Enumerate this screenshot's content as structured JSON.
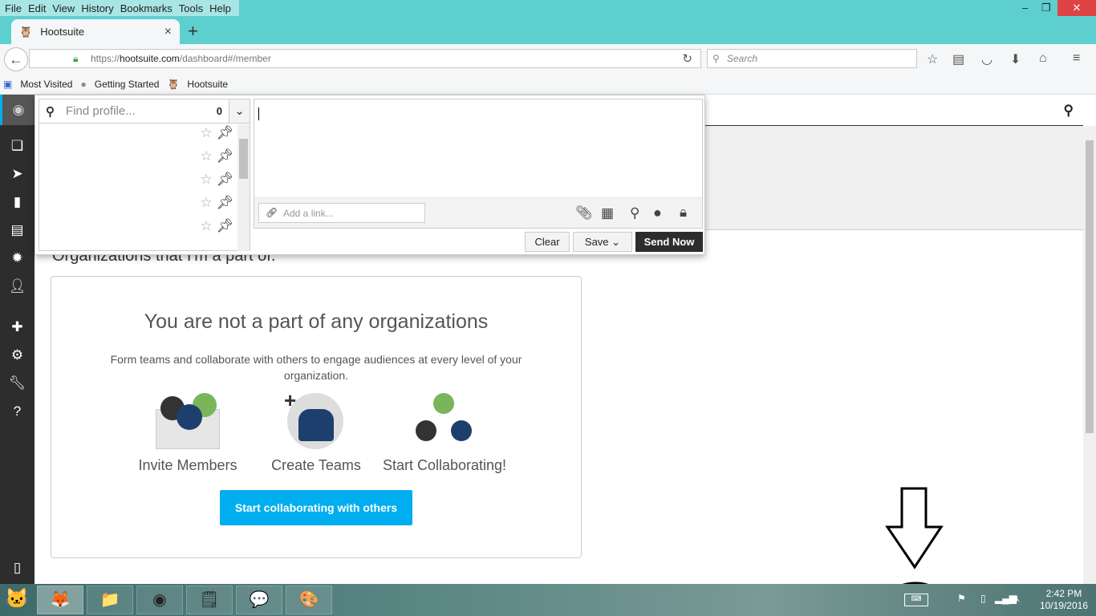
{
  "menu": [
    "File",
    "Edit",
    "View",
    "History",
    "Bookmarks",
    "Tools",
    "Help"
  ],
  "tab": {
    "title": "Hootsuite",
    "new_tab": "+",
    "close": "×"
  },
  "window": {
    "minimize": "–",
    "restore": "❐",
    "close": "✕"
  },
  "nav": {
    "url_prefix": "https://",
    "url_host": "hootsuite.com",
    "url_path": "/dashboard#/member",
    "search_placeholder": "Search"
  },
  "bookmarks": [
    "Most Visited",
    "Getting Started",
    "Hootsuite"
  ],
  "composer": {
    "find_placeholder": "Find profile...",
    "profile_count": "0",
    "link_placeholder": "Add a link...",
    "clear": "Clear",
    "save": "Save",
    "send": "Send Now"
  },
  "page": {
    "section_heading": "Organizations that I'm a part of.",
    "card_title": "You are not a part of any organizations",
    "card_text": "Form teams and collaborate with others to engage audiences at every level of your organization.",
    "steps": [
      "Invite Members",
      "Create Teams",
      "Start Collaborating!"
    ],
    "cta": "Start collaborating with others"
  },
  "taskbar": {
    "time": "2:42 PM",
    "date": "10/19/2016"
  },
  "colors": {
    "accent": "#00aeef",
    "sidebar": "#2d2d2d",
    "browser_chrome": "#5ecfcf"
  }
}
